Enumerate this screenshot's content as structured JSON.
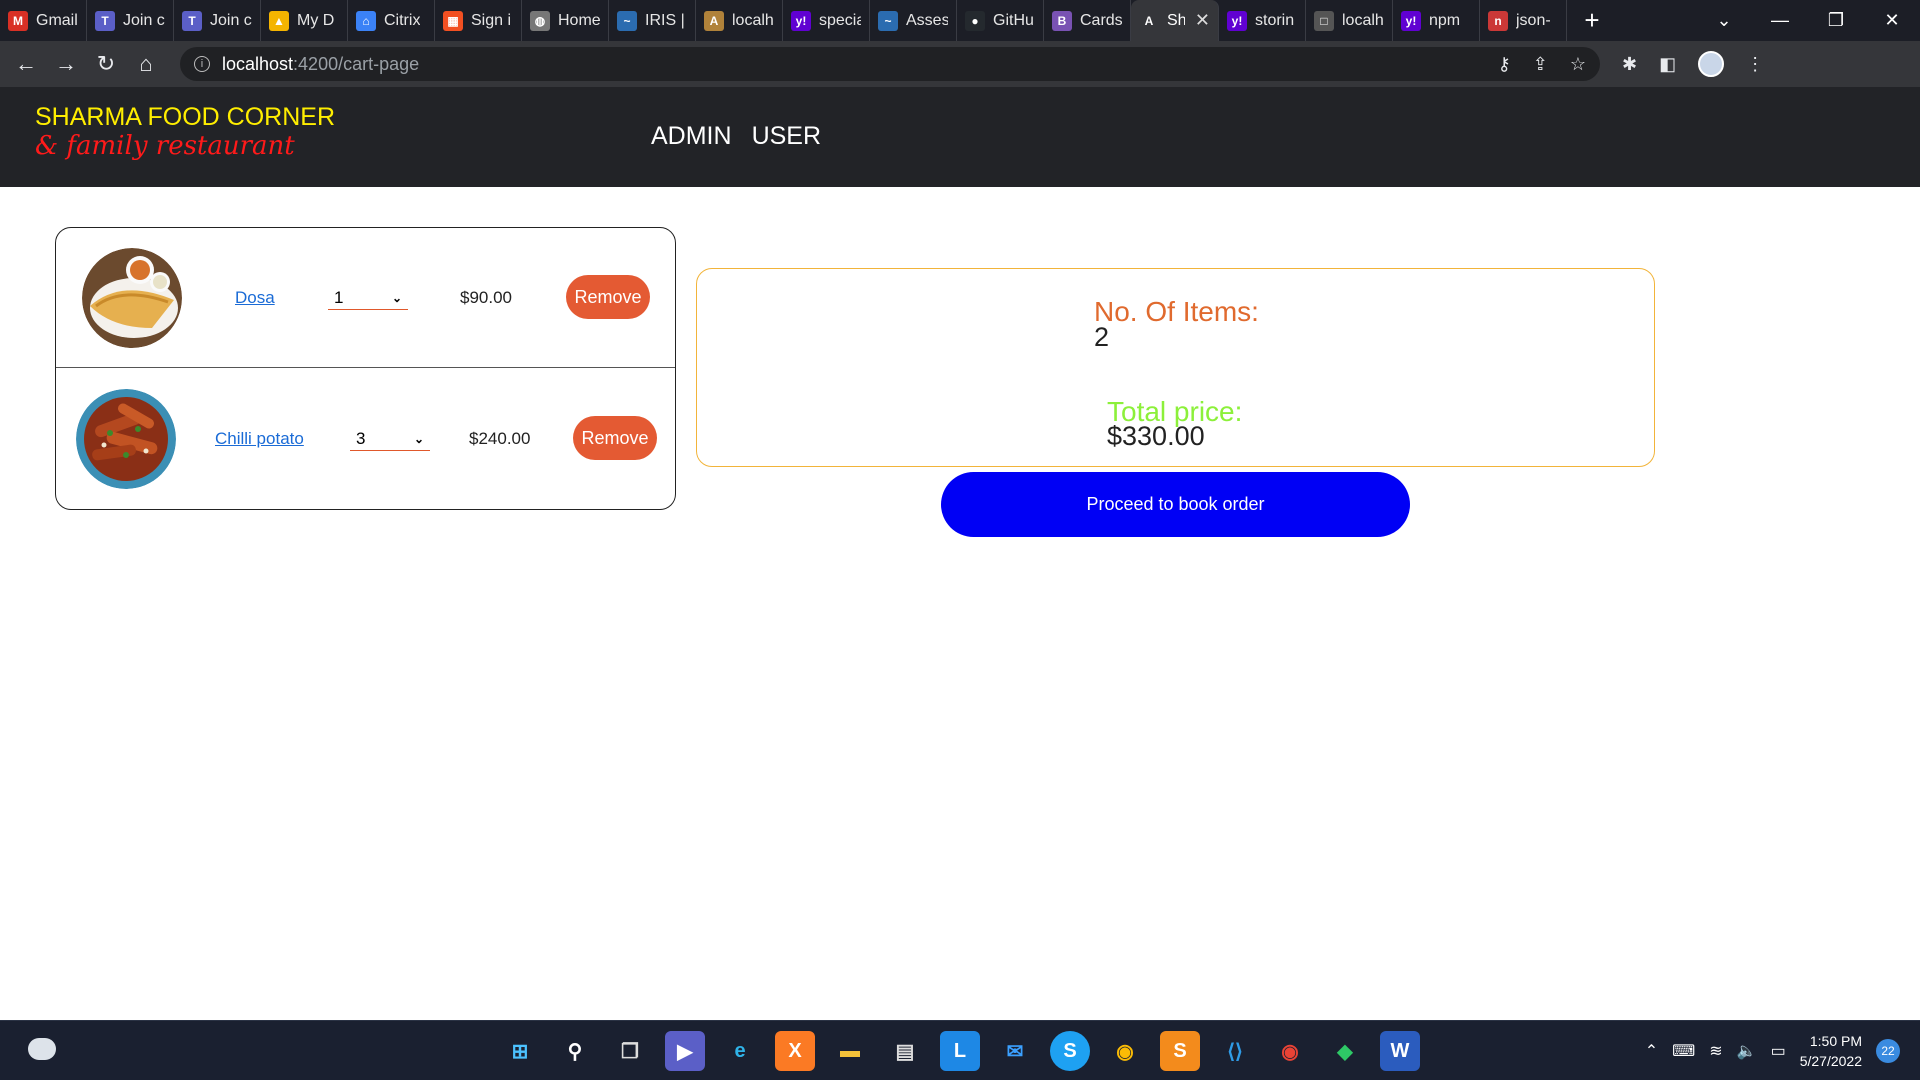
{
  "browser": {
    "tabs": [
      {
        "label": "Gmail",
        "icon": "gmail-icon",
        "color": "#d93025",
        "glyph": "M"
      },
      {
        "label": "Join c",
        "icon": "teams-icon",
        "color": "#5b5fc7",
        "glyph": "T"
      },
      {
        "label": "Join c",
        "icon": "teams-icon",
        "color": "#5b5fc7",
        "glyph": "T"
      },
      {
        "label": "My D",
        "icon": "drive-icon",
        "color": "#f4b400",
        "glyph": "▲"
      },
      {
        "label": "Citrix",
        "icon": "lock-icon",
        "color": "#3b82f6",
        "glyph": "⌂"
      },
      {
        "label": "Sign i",
        "icon": "microsoft-icon",
        "color": "#f25022",
        "glyph": "▦"
      },
      {
        "label": "Home",
        "icon": "globe-icon",
        "color": "#777777",
        "glyph": "◍"
      },
      {
        "label": "IRIS |",
        "icon": "iris-icon",
        "color": "#2b6cb0",
        "glyph": "~"
      },
      {
        "label": "localh",
        "icon": "angular-icon",
        "color": "#b0823a",
        "glyph": "A"
      },
      {
        "label": "specia",
        "icon": "yahoo-icon",
        "color": "#6001d2",
        "glyph": "y!"
      },
      {
        "label": "Asses",
        "icon": "iris-icon",
        "color": "#2b6cb0",
        "glyph": "~"
      },
      {
        "label": "GitHu",
        "icon": "github-icon",
        "color": "#24292e",
        "glyph": "●"
      },
      {
        "label": "Cards",
        "icon": "bootstrap-icon",
        "color": "#7952b3",
        "glyph": "B"
      },
      {
        "label": "Sh",
        "icon": "angular-icon",
        "color": "#35363a",
        "glyph": "A"
      },
      {
        "label": "storin",
        "icon": "yahoo-icon",
        "color": "#6001d2",
        "glyph": "y!"
      },
      {
        "label": "localh",
        "icon": "page-icon",
        "color": "#555555",
        "glyph": "□"
      },
      {
        "label": "npm",
        "icon": "yahoo-icon",
        "color": "#6001d2",
        "glyph": "y!"
      },
      {
        "label": "json-",
        "icon": "npm-icon",
        "color": "#cb3837",
        "glyph": "n"
      }
    ],
    "url_host": "localhost",
    "url_path": ":4200/cart-page"
  },
  "site": {
    "brand_line1": "SHARMA FOOD CORNER",
    "brand_line2": "& family restaurant",
    "nav": {
      "admin": "ADMIN",
      "user": "USER"
    }
  },
  "cart": {
    "items": [
      {
        "name": "Dosa",
        "quantity": "1",
        "price": "$90.00",
        "remove_label": "Remove"
      },
      {
        "name": "Chilli potato",
        "quantity": "3",
        "price": "$240.00",
        "remove_label": "Remove"
      }
    ]
  },
  "summary": {
    "items_label": "No. Of Items:",
    "items_count": "2",
    "price_label": "Total price:",
    "total_price": "$330.00",
    "proceed_label": "Proceed to book order"
  },
  "taskbar": {
    "time": "1:50 PM",
    "date": "5/27/2022",
    "notifications": "22"
  },
  "colors": {
    "header_bg": "#222327",
    "brand_yellow": "#ffee00",
    "brand_red": "#ff1a1a",
    "remove_orange": "#e45a33",
    "proceed_blue": "#0000f5",
    "items_label_orange": "#e06a2e",
    "price_label_green": "#8cf03a",
    "summary_border": "#f2b43a"
  }
}
